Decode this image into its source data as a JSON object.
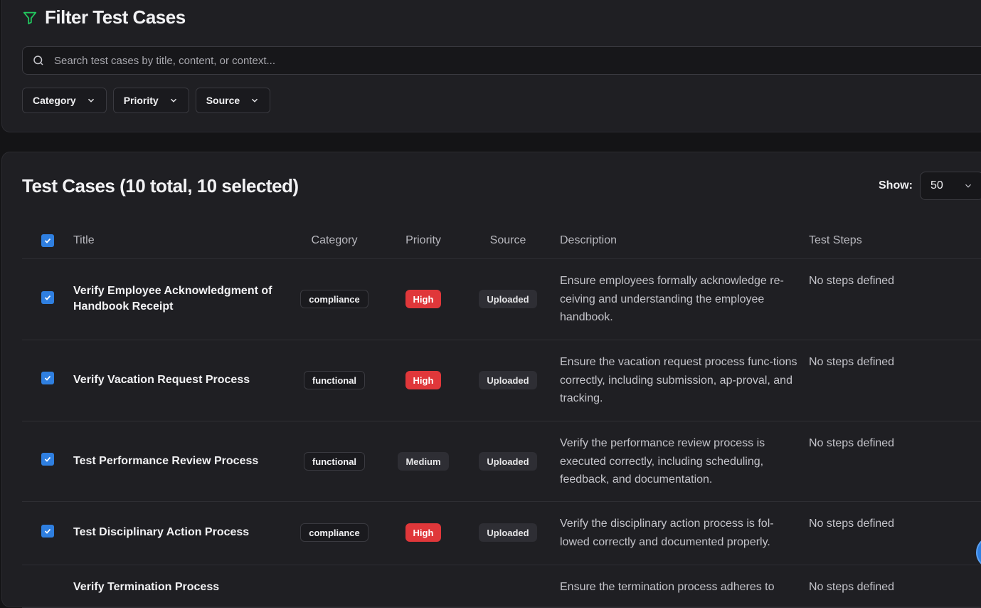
{
  "filter": {
    "title": "Filter Test Cases",
    "search_placeholder": "Search test cases by title, content, or context...",
    "dropdowns": [
      "Category",
      "Priority",
      "Source"
    ],
    "accent_color": "#22c55e"
  },
  "cases": {
    "title": "Test Cases (10 total, 10 selected)",
    "show_label": "Show:",
    "show_value": "50",
    "headers": {
      "title": "Title",
      "category": "Category",
      "priority": "Priority",
      "source": "Source",
      "description": "Description",
      "steps": "Test Steps"
    },
    "rows": [
      {
        "title": "Verify Employee Acknowledgment of Handbook Receipt",
        "category": "compliance",
        "priority": "High",
        "source": "Uploaded",
        "description": "Ensure employees formally acknowledge re-ceiving and understanding the employee handbook.",
        "steps": "No steps defined",
        "checked": true
      },
      {
        "title": "Verify Vacation Request Process",
        "category": "functional",
        "priority": "High",
        "source": "Uploaded",
        "description": "Ensure the vacation request process func-tions correctly, including submission, ap-proval, and tracking.",
        "steps": "No steps defined",
        "checked": true
      },
      {
        "title": "Test Performance Review Process",
        "category": "functional",
        "priority": "Medium",
        "source": "Uploaded",
        "description": "Verify the performance review process is executed correctly, including scheduling, feedback, and documentation.",
        "steps": "No steps defined",
        "checked": true
      },
      {
        "title": "Test Disciplinary Action Process",
        "category": "compliance",
        "priority": "High",
        "source": "Uploaded",
        "description": "Verify the disciplinary action process is fol-lowed correctly and documented properly.",
        "steps": "No steps defined",
        "checked": true
      },
      {
        "title": "Verify Termination Process",
        "category": "",
        "priority": "",
        "source": "",
        "description": "Ensure the termination process adheres to",
        "steps": "No steps defined",
        "checked": true
      }
    ]
  },
  "colors": {
    "checkbox": "#2f7fe0",
    "high": "#e0373a"
  }
}
